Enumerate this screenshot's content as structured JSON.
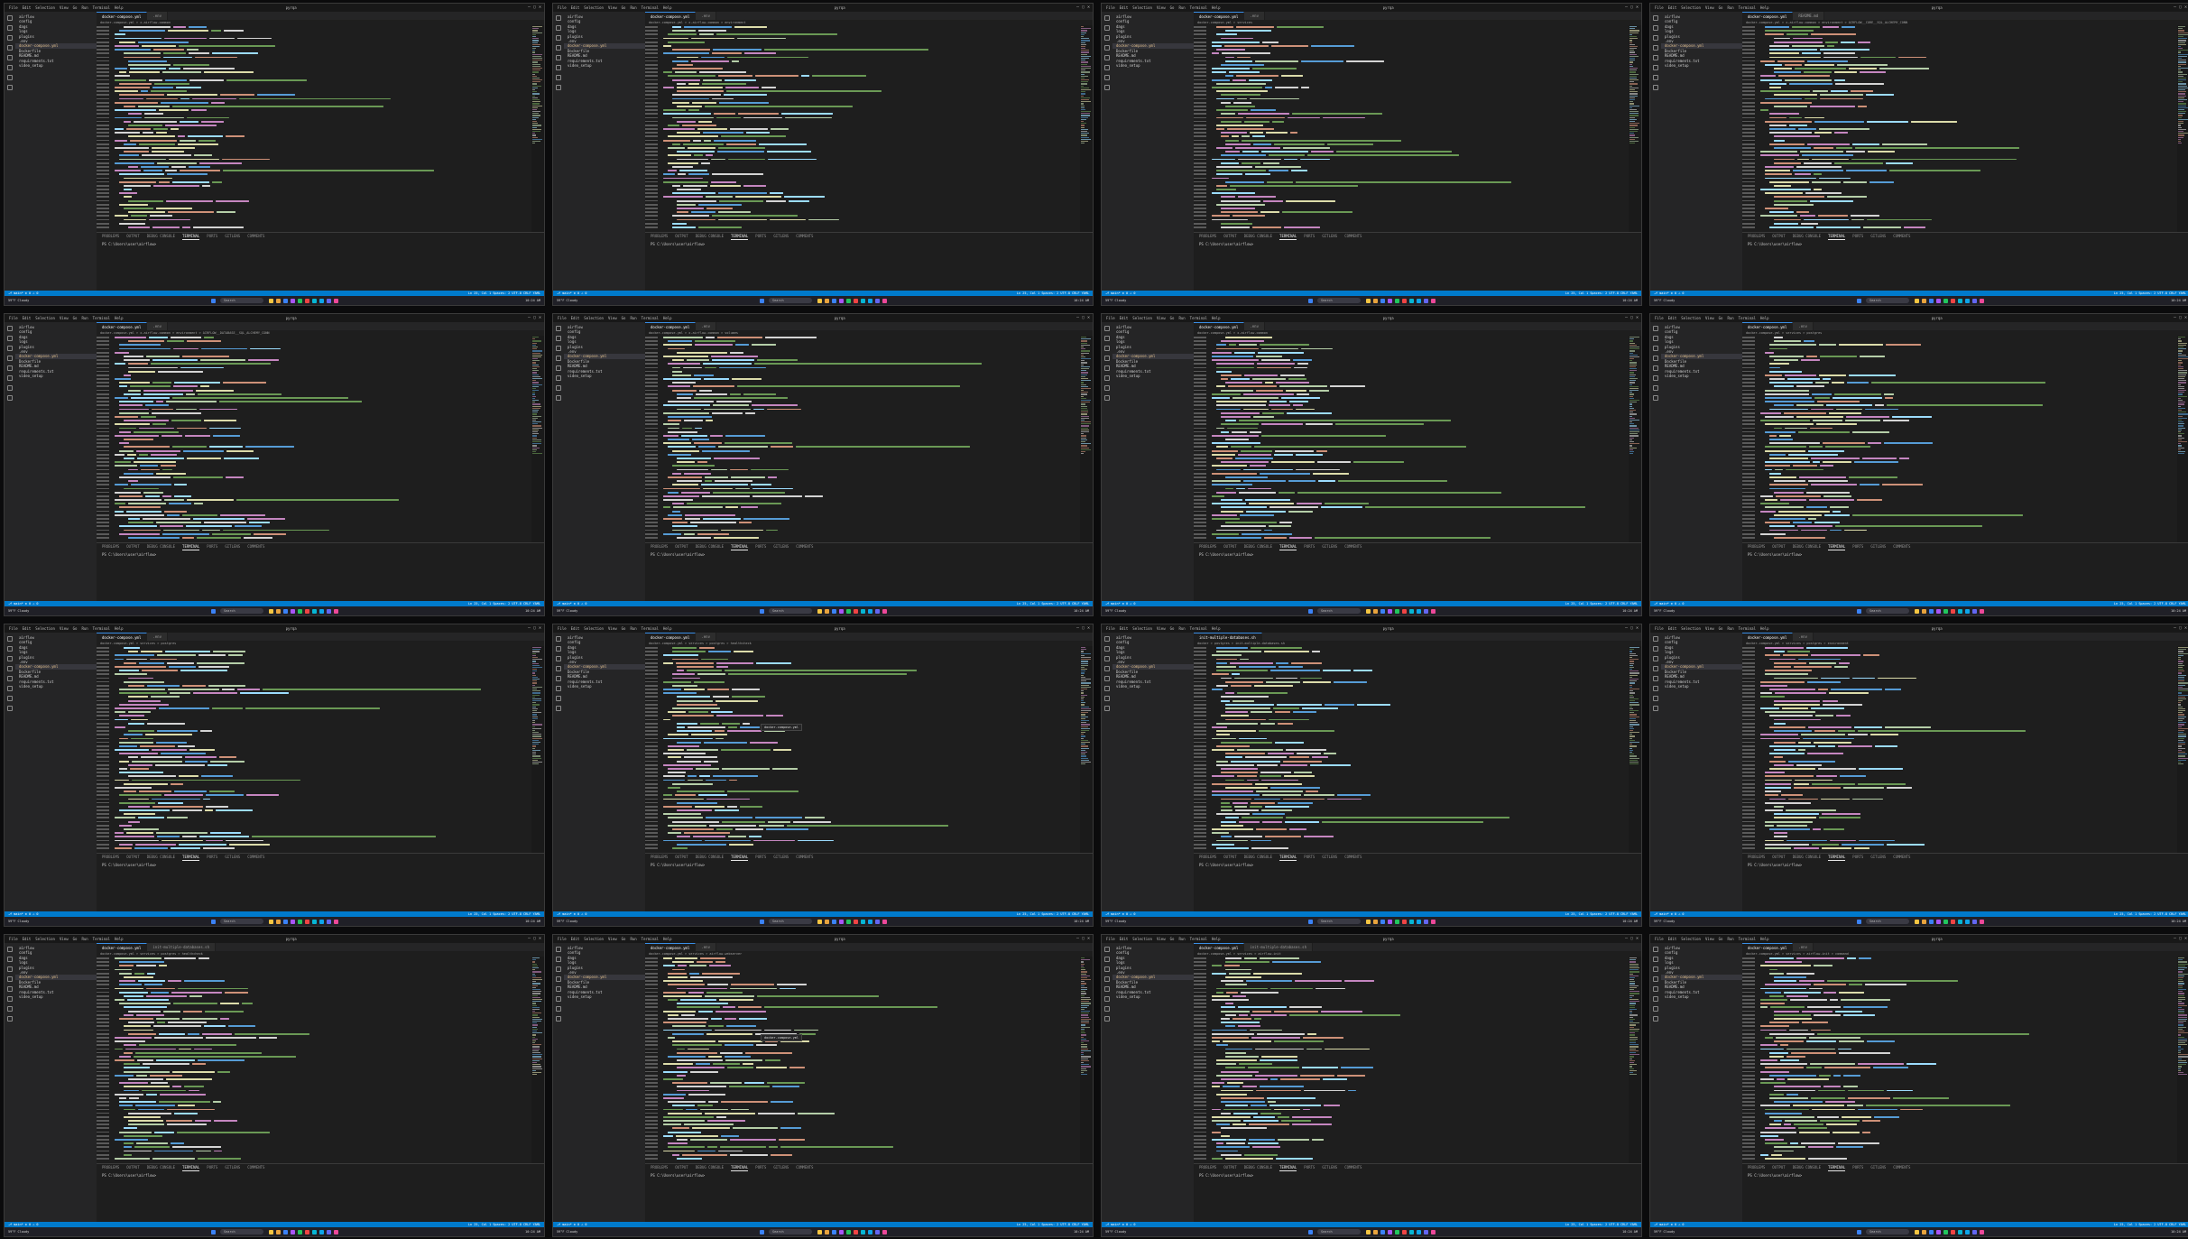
{
  "layout": "4x4 grid of VS Code screenshots",
  "menu": [
    "File",
    "Edit",
    "Selection",
    "View",
    "Go",
    "Run",
    "Terminal",
    "Help"
  ],
  "window_title": "pyrqa",
  "sidebar_items": [
    {
      "label": "airflow",
      "section": true
    },
    {
      "label": "config"
    },
    {
      "label": "dags"
    },
    {
      "label": "logs"
    },
    {
      "label": "plugins"
    },
    {
      "label": ".env"
    },
    {
      "label": "docker-compose.yml",
      "selected": true,
      "modified": true
    },
    {
      "label": "Dockerfile"
    },
    {
      "label": "README.md"
    },
    {
      "label": "requirements.txt"
    },
    {
      "label": "video_setup"
    }
  ],
  "panel_tabs": [
    "PROBLEMS",
    "OUTPUT",
    "DEBUG CONSOLE",
    "TERMINAL",
    "PORTS",
    "GITLENS",
    "COMMENTS"
  ],
  "terminal_prompt": "PS C:\\Users\\user\\airflow>",
  "status": {
    "left": "⎇ main*  ⊗ 0 ⚠ 0",
    "right": "Ln 25, Col 1  Spaces: 2  UTF-8  CRLF  YAML"
  },
  "taskbar": {
    "search_placeholder": "Search",
    "weather": "59°F Cloudy",
    "clock": "10:24 AM",
    "icon_colors": [
      "#f4c542",
      "#e8a33d",
      "#3b82f6",
      "#a855f7",
      "#22c55e",
      "#ef4444",
      "#06b6d4",
      "#0ea5e9",
      "#6366f1",
      "#ec4899"
    ]
  },
  "tiles": [
    {
      "tabs": [
        "docker-compose.yml",
        ".env"
      ],
      "breadcrumb": "docker-compose.yml > x-airflow-common",
      "popup": null
    },
    {
      "tabs": [
        "docker-compose.yml",
        ".env"
      ],
      "breadcrumb": "docker-compose.yml > x-airflow-common > environment",
      "popup": null
    },
    {
      "tabs": [
        "docker-compose.yml",
        ".env"
      ],
      "breadcrumb": "docker-compose.yml > services",
      "popup": null
    },
    {
      "tabs": [
        "docker-compose.yml",
        "README.md"
      ],
      "breadcrumb": "docker-compose.yml > x-airflow-common > environment > AIRFLOW__CORE__SQL_ALCHEMY_CONN",
      "popup": null
    },
    {
      "tabs": [
        "docker-compose.yml",
        ".env"
      ],
      "breadcrumb": "docker-compose.yml > x-airflow-common > environment > AIRFLOW__DATABASE__SQL_ALCHEMY_CONN",
      "popup": null
    },
    {
      "tabs": [
        "docker-compose.yml",
        ".env"
      ],
      "breadcrumb": "docker-compose.yml > x-airflow-common > volumes",
      "popup": null
    },
    {
      "tabs": [
        "docker-compose.yml",
        ".env"
      ],
      "breadcrumb": "docker-compose.yml > x-airflow-common",
      "popup": null
    },
    {
      "tabs": [
        "docker-compose.yml",
        ".env"
      ],
      "breadcrumb": "docker-compose.yml > services > postgres",
      "popup": null
    },
    {
      "tabs": [
        "docker-compose.yml",
        ".env"
      ],
      "breadcrumb": "docker-compose.yml > services > postgres",
      "popup": null
    },
    {
      "tabs": [
        "docker-compose.yml",
        ".env"
      ],
      "breadcrumb": "docker-compose.yml > services > postgres > healthcheck",
      "popup": "docker-compose.yml"
    },
    {
      "tabs": [
        "init-multiple-databases.sh"
      ],
      "breadcrumb": "docker > postgres > init-multiple-databases.sh",
      "popup": null
    },
    {
      "tabs": [
        "docker-compose.yml",
        ".env"
      ],
      "breadcrumb": "docker-compose.yml > services > postgres > environment",
      "popup": null
    },
    {
      "tabs": [
        "docker-compose.yml",
        "init-multiple-databases.sh"
      ],
      "breadcrumb": "docker-compose.yml > services > postgres > healthcheck",
      "popup": null
    },
    {
      "tabs": [
        "docker-compose.yml",
        ".env"
      ],
      "breadcrumb": "docker-compose.yml > services > airflow-webserver",
      "popup": "docker-compose.yml"
    },
    {
      "tabs": [
        "docker-compose.yml",
        "init-multiple-databases.sh"
      ],
      "breadcrumb": "docker-compose.yml > services > airflow-init",
      "popup": null
    },
    {
      "tabs": [
        "docker-compose.yml",
        ".env"
      ],
      "breadcrumb": "docker-compose.yml > services > airflow-init > command",
      "popup": null
    }
  ]
}
